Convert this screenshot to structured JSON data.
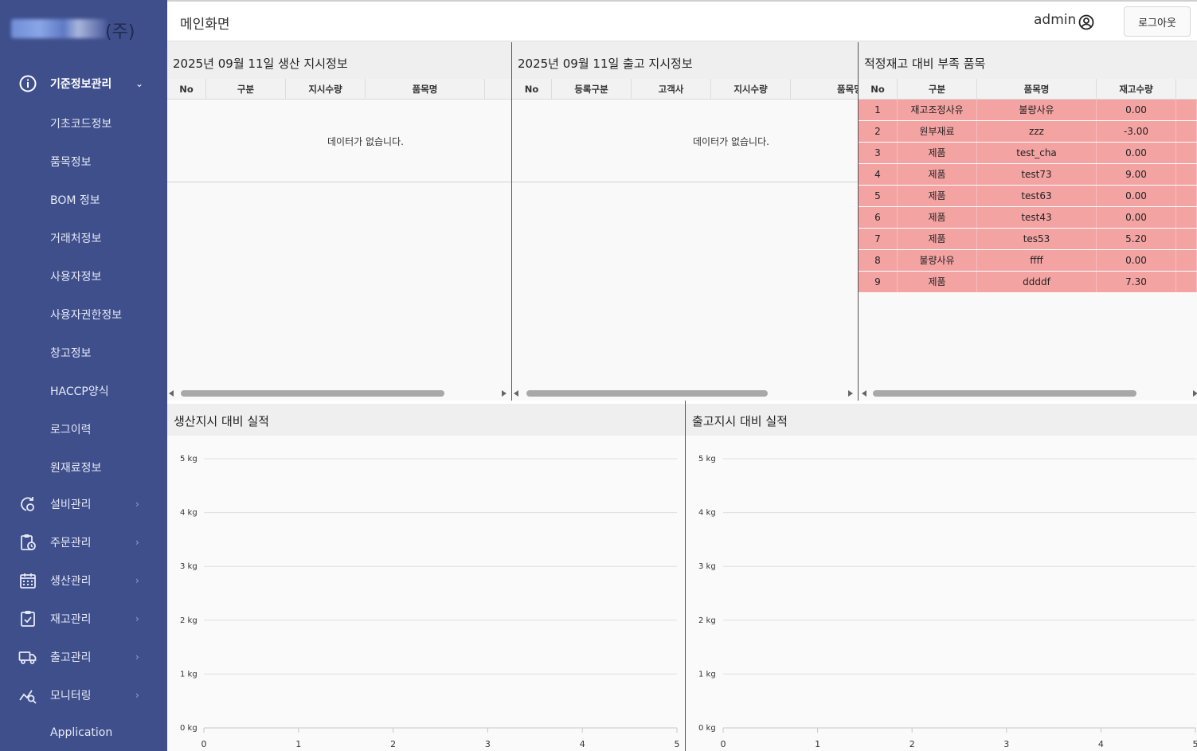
{
  "app": {
    "company_suffix": "(주)"
  },
  "sidebar": {
    "sections": [
      {
        "label": "기준정보관리",
        "icon": "info-circle-icon",
        "expanded": true
      },
      {
        "label": "설비관리",
        "icon": "gear-refresh-icon"
      },
      {
        "label": "주문관리",
        "icon": "clipboard-clock-icon"
      },
      {
        "label": "생산관리",
        "icon": "calendar-icon"
      },
      {
        "label": "재고관리",
        "icon": "clipboard-check-icon"
      },
      {
        "label": "출고관리",
        "icon": "truck-icon"
      },
      {
        "label": "모니터링",
        "icon": "chart-search-icon"
      }
    ],
    "sub_items": [
      "기초코드정보",
      "품목정보",
      "BOM 정보",
      "거래처정보",
      "사용자정보",
      "사용자권한정보",
      "창고정보",
      "HACCP양식",
      "로그이력",
      "원재료정보"
    ],
    "footer": "Application"
  },
  "header": {
    "page_title": "메인화면",
    "user": "admin",
    "logout_label": "로그아웃"
  },
  "panels": {
    "production": {
      "title": "2025년 09월 11일 생산 지시정보",
      "columns": [
        "No",
        "구분",
        "지시수량",
        "품목명"
      ],
      "empty_text": "데이터가 없습니다."
    },
    "shipping": {
      "title": "2025년 09월 11일 출고 지시정보",
      "columns": [
        "No",
        "등록구분",
        "고객사",
        "지시수량",
        "품목명"
      ],
      "empty_text": "데이터가 없습니다."
    },
    "shortage": {
      "title": "적정재고 대비 부족 품목",
      "columns": [
        "No",
        "구분",
        "품목명",
        "재고수량"
      ],
      "rows": [
        [
          "1",
          "재고조정사유",
          "불량사유",
          "0.00"
        ],
        [
          "2",
          "원부재료",
          "zzz",
          "-3.00"
        ],
        [
          "3",
          "제품",
          "test_cha",
          "0.00"
        ],
        [
          "4",
          "제품",
          "test73",
          "9.00"
        ],
        [
          "5",
          "제품",
          "test63",
          "0.00"
        ],
        [
          "6",
          "제품",
          "test43",
          "0.00"
        ],
        [
          "7",
          "제품",
          "tes53",
          "5.20"
        ],
        [
          "8",
          "불량사유",
          "ffff",
          "0.00"
        ],
        [
          "9",
          "제품",
          "ddddf",
          "7.30"
        ]
      ]
    }
  },
  "chart_data": [
    {
      "type": "bar",
      "title": "생산지시 대비 실적",
      "y_ticks": [
        "0 kg",
        "1 kg",
        "2 kg",
        "3 kg",
        "4 kg",
        "5 kg"
      ],
      "x_ticks": [
        "0",
        "1",
        "2",
        "3",
        "4",
        "5"
      ],
      "xlim": [
        0,
        5
      ],
      "ylim": [
        0,
        5
      ],
      "series": [],
      "grid": true
    },
    {
      "type": "bar",
      "title": "출고지시 대비 실적",
      "y_ticks": [
        "0 kg",
        "1 kg",
        "2 kg",
        "3 kg",
        "4 kg",
        "5 kg"
      ],
      "x_ticks": [
        "0",
        "1",
        "2",
        "3",
        "4",
        "5"
      ],
      "xlim": [
        0,
        5
      ],
      "ylim": [
        0,
        5
      ],
      "series": [],
      "grid": true
    }
  ],
  "colors": {
    "sidebar_bg": "#3f4f8c",
    "shortage_row": "#f4a3a3"
  }
}
